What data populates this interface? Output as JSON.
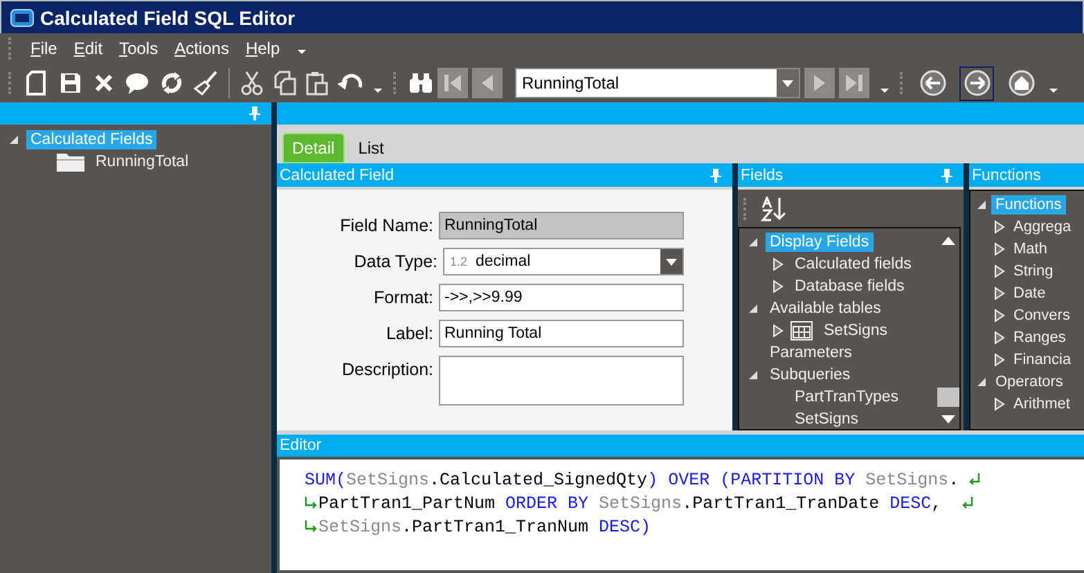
{
  "window": {
    "title": "Calculated Field SQL Editor"
  },
  "menu": [
    "File",
    "Edit",
    "Tools",
    "Actions",
    "Help"
  ],
  "toolbar": {
    "record_combo": {
      "value": "RunningTotal"
    },
    "nav_buttons": [
      {
        "disabled": true
      },
      {
        "disabled": true
      },
      {
        "disabled": true
      },
      {
        "disabled": true
      }
    ],
    "history_buttons": [
      {
        "hovered": false
      },
      {
        "hovered": true
      },
      {
        "hovered": false
      }
    ]
  },
  "left_pane": {
    "tree": [
      {
        "label": "Calculated Fields",
        "expanded": true,
        "selected": true,
        "kind": "node",
        "children": [
          {
            "label": "RunningTotal",
            "kind": "folder",
            "selected": false
          }
        ]
      }
    ]
  },
  "tabs": [
    {
      "label": "Detail",
      "selected": true
    },
    {
      "label": "List",
      "selected": false
    }
  ],
  "calculated_field": {
    "title": "Calculated Field",
    "fields": [
      {
        "label": "Field Name:",
        "kind": "text",
        "value": "RunningTotal",
        "disabled": true
      },
      {
        "label": "Data Type:",
        "kind": "select",
        "badge": "1.2",
        "value": "decimal"
      },
      {
        "label": "Format:",
        "kind": "text",
        "value": "->>,>>9.99",
        "disabled": false
      },
      {
        "label": "Label:",
        "kind": "text",
        "value": "Running Total",
        "disabled": false
      },
      {
        "label": "Description:",
        "kind": "textarea"
      }
    ]
  },
  "fields_panel": {
    "title": "Fields",
    "tree": [
      {
        "label": "Display Fields",
        "kind": "node",
        "expanded": true,
        "selected": true,
        "children": [
          {
            "label": "Calculated fields",
            "kind": "node",
            "expanded": false,
            "selected": false
          },
          {
            "label": "Database fields",
            "kind": "node",
            "expanded": false,
            "selected": false
          }
        ]
      },
      {
        "label": "Available tables",
        "kind": "node",
        "expanded": true,
        "selected": false,
        "children": [
          {
            "label": "SetSigns",
            "kind": "table",
            "expanded": false,
            "selected": false
          }
        ]
      },
      {
        "label": "Parameters",
        "kind": "node",
        "selected": false
      },
      {
        "label": "Subqueries",
        "kind": "node",
        "expanded": true,
        "selected": false,
        "children": [
          {
            "label": "PartTranTypes",
            "kind": "node",
            "selected": false
          },
          {
            "label": "SetSigns",
            "kind": "node",
            "selected": false
          }
        ]
      }
    ]
  },
  "functions_panel": {
    "title": "Functions",
    "tree": [
      {
        "label": "Functions",
        "expanded": true,
        "selected": true,
        "children": [
          {
            "label": "Aggrega",
            "expanded": false,
            "selected": false
          },
          {
            "label": "Math",
            "expanded": false,
            "selected": false
          },
          {
            "label": "String",
            "expanded": false,
            "selected": false
          },
          {
            "label": "Date",
            "expanded": false,
            "selected": false
          },
          {
            "label": "Convers",
            "expanded": false,
            "selected": false
          },
          {
            "label": "Ranges",
            "expanded": false,
            "selected": false
          },
          {
            "label": "Financia",
            "expanded": false,
            "selected": false
          }
        ]
      },
      {
        "label": "Operators",
        "expanded": true,
        "selected": false,
        "children": [
          {
            "label": "Arithmet",
            "expanded": false,
            "selected": false
          }
        ]
      }
    ]
  },
  "editor": {
    "title": "Editor",
    "lines": [
      {
        "continued": false,
        "wraps": true,
        "tokens": [
          {
            "kind": "keyword",
            "text": "SUM("
          },
          {
            "kind": "table",
            "text": "SetSigns"
          },
          {
            "kind": "plain",
            "text": ".Calculated_SignedQty"
          },
          {
            "kind": "keyword",
            "text": ") OVER (PARTITION BY "
          },
          {
            "kind": "table",
            "text": "SetSigns"
          },
          {
            "kind": "plain",
            "text": "."
          }
        ]
      },
      {
        "continued": true,
        "wraps": true,
        "tokens": [
          {
            "kind": "plain",
            "text": "PartTran1_PartNum "
          },
          {
            "kind": "keyword",
            "text": "ORDER BY "
          },
          {
            "kind": "table",
            "text": "SetSigns"
          },
          {
            "kind": "plain",
            "text": ".PartTran1_TranDate "
          },
          {
            "kind": "keyword",
            "text": "DESC"
          },
          {
            "kind": "plain",
            "text": ", "
          }
        ]
      },
      {
        "continued": true,
        "wraps": false,
        "tokens": [
          {
            "kind": "table",
            "text": "SetSigns"
          },
          {
            "kind": "plain",
            "text": ".PartTran1_TranNum "
          },
          {
            "kind": "keyword",
            "text": "DESC)"
          }
        ]
      }
    ]
  }
}
